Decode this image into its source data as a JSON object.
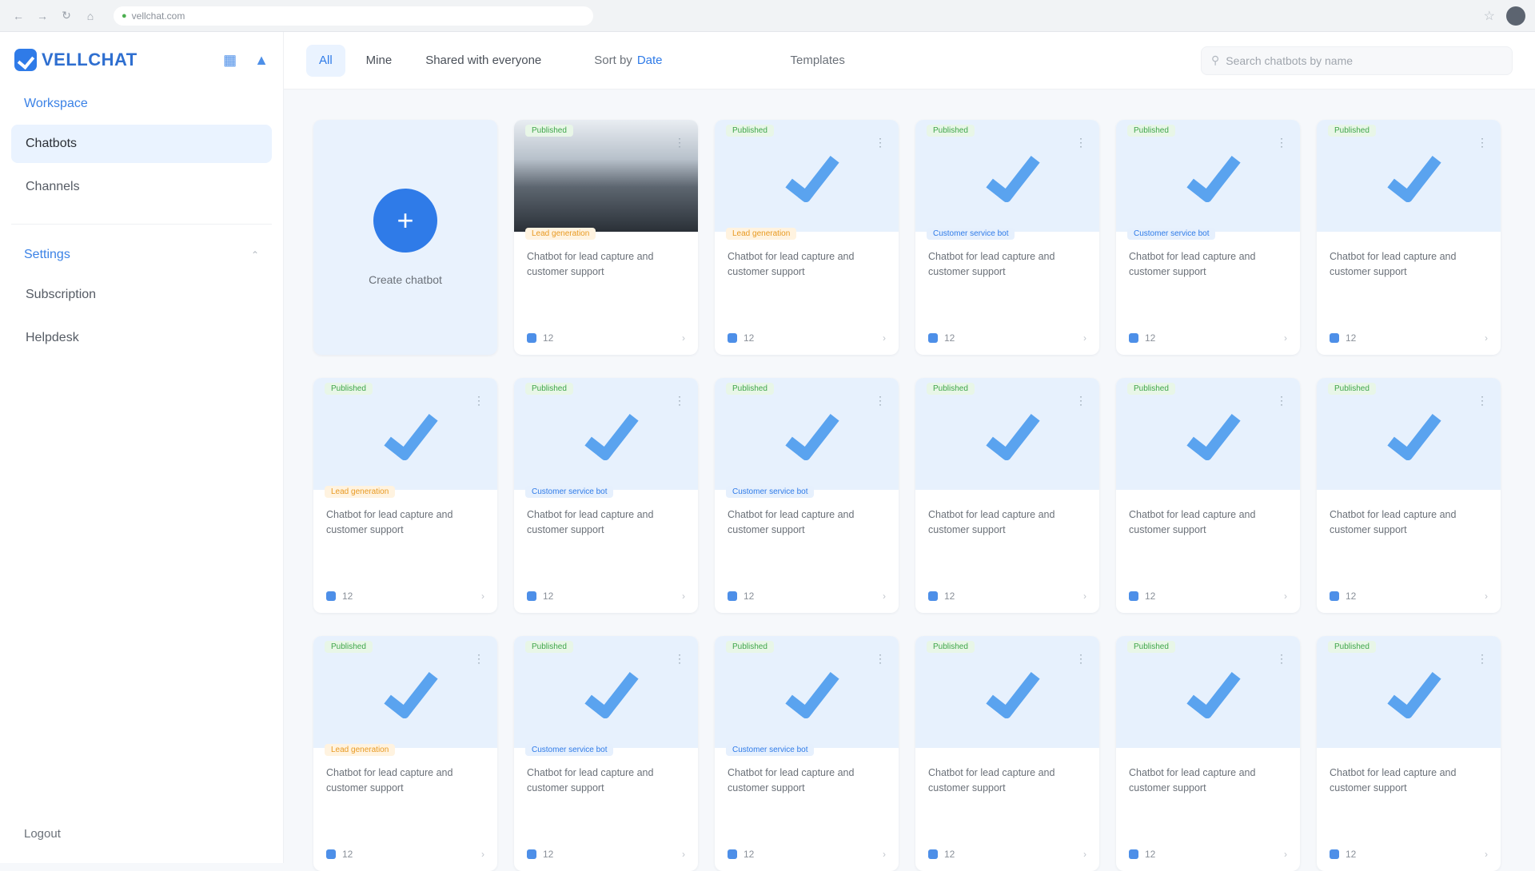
{
  "browser": {
    "url": "vellchat.com"
  },
  "brand": {
    "logo": "VELLCHAT"
  },
  "sidebar": {
    "section1_title": "Workspace",
    "items1": [
      "Chatbots",
      "Channels"
    ],
    "section2_title": "Settings",
    "items2": [
      "Subscription",
      "Helpdesk"
    ],
    "footer": "Logout"
  },
  "toolbar": {
    "tabs": [
      "All",
      "Mine",
      "Shared with everyone"
    ],
    "sort_label": "Sort by",
    "sort_value": "Date",
    "center_label": "Templates",
    "search_placeholder": "Search chatbots by name"
  },
  "grid": {
    "create_label": "Create chatbot",
    "status_label": "Published",
    "lane_orange": "Lead generation",
    "lane_blue": "Customer service bot",
    "card_desc": "Chatbot for lead capture and customer support",
    "count": "12"
  },
  "colors": {
    "accent": "#2f7be8",
    "status_green": "#3fa64a",
    "lane_orange": "#e89a22"
  }
}
